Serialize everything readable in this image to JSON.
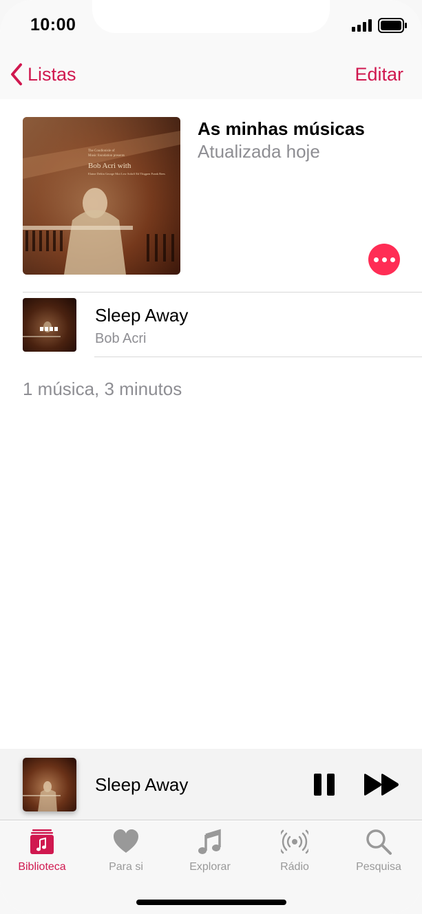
{
  "status_bar": {
    "time": "10:00"
  },
  "nav": {
    "back_label": "Listas",
    "edit_label": "Editar"
  },
  "playlist": {
    "title": "As minhas músicas",
    "subtitle": "Atualizada hoje",
    "cover_lines": [
      "The Coudlonisle of",
      "Music foundation presents",
      "Bob Acri with",
      "Elaine Deltin George Moi Lew Soloff Ed Thigpen Frank Rees"
    ]
  },
  "songs": [
    {
      "title": "Sleep Away",
      "artist": "Bob Acri"
    }
  ],
  "summary": "1 música, 3 minutos",
  "now_playing": {
    "title": "Sleep Away"
  },
  "tabs": [
    {
      "label": "Biblioteca",
      "icon": "library-icon",
      "active": true
    },
    {
      "label": "Para si",
      "icon": "heart-icon",
      "active": false
    },
    {
      "label": "Explorar",
      "icon": "music-note-icon",
      "active": false
    },
    {
      "label": "Rádio",
      "icon": "radio-icon",
      "active": false
    },
    {
      "label": "Pesquisa",
      "icon": "search-icon",
      "active": false
    }
  ],
  "colors": {
    "accent": "#d0184f",
    "more_button": "#ff2d55",
    "secondary_text": "#8e8e93",
    "inactive_tab": "#999999"
  }
}
